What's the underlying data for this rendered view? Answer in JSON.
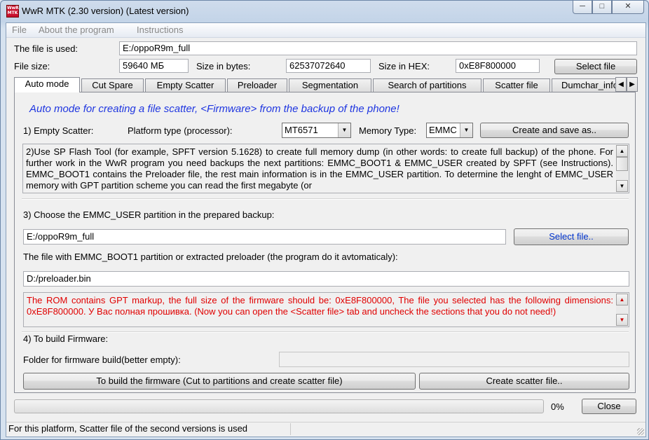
{
  "window": {
    "title": "WwR MTK (2.30 version) (Latest version)",
    "icon_text": "WwR MTK",
    "controls": {
      "minimize": "─",
      "maximize": "□",
      "close": "✕"
    }
  },
  "menu": [
    "File",
    "About the program",
    "Instructions"
  ],
  "file_info": {
    "used_label": "The file is used:",
    "used_value": "E:/oppoR9m_full",
    "size_label": "File size:",
    "size_value": "59640 МБ",
    "bytes_label": "Size in bytes:",
    "bytes_value": "62537072640",
    "hex_label": "Size in HEX:",
    "hex_value": "0xE8F800000",
    "select_button": "Select file"
  },
  "tabs": [
    "Auto mode",
    "Cut Spare",
    "Empty Scatter",
    "Preloader",
    "Segmentation",
    "Search of partitions",
    "Scatter file",
    "Dumchar_info"
  ],
  "tab_scroll": {
    "left": "◀",
    "right": "▶"
  },
  "auto": {
    "heading": "Auto mode for creating a file scatter, <Firmware> from the backup of the phone!",
    "step1_label": "1) Empty Scatter:",
    "platform_label": "Platform type (processor):",
    "platform_value": "MT6571",
    "memory_label": "Memory Type:",
    "memory_value": "EMMC",
    "create_button": "Create and save as..",
    "step2_text": "2)Use SP Flash Tool (for example, SPFT version 5.1628) to create full memory dump (in other words: to create full backup) of the phone. For further work in the WwR program you need backups the next partitions: EMMC_BOOT1 & EMMC_USER created by SPFT (see Instructions). EMMC_BOOT1 contains the Preloader file, the rest main information is in the EMMC_USER partition. To determine the lenght of EMMC_USER memory with GPT partition scheme you can read the first megabyte (or",
    "step3_label": "3) Choose the EMMC_USER partition in the prepared backup:",
    "step3_path": "E:/oppoR9m_full",
    "step3_button": "Select file..",
    "boot_label": "The file with EMMC_BOOT1 partition or extracted preloader (the program do it avtomaticaly):",
    "boot_path": "D:/preloader.bin",
    "rom_message": "The ROM contains GPT markup, the full size of the firmware should be: 0xE8F800000, The file you selected has the following dimensions:  0xE8F800000. У Вас полная прошивка.  (Now you can open the <Scatter file> tab and uncheck the sections that you do not need!)",
    "step4_label": "4) To build Firmware:",
    "folder_label": "Folder for firmware build(better empty):",
    "folder_value": "",
    "build_button": "To build the firmware (Cut to partitions and create scatter file)",
    "scatter_button": "Create scatter file.."
  },
  "progress": {
    "value": 0,
    "text": "0%"
  },
  "close_button": "Close",
  "status": "For this platform, Scatter file of the second versions is used",
  "colors": {
    "heading": "#1f36e0",
    "error_text": "#e00000"
  }
}
